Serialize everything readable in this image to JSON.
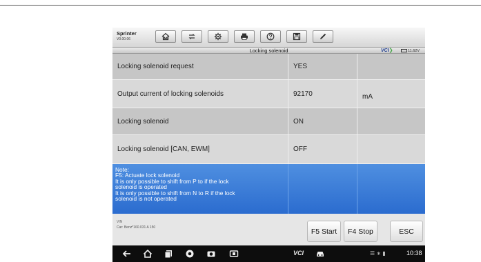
{
  "app": {
    "name": "Sprinter",
    "version": "V0.00.06"
  },
  "toolbar": {
    "buttons": [
      {
        "icon": "home-icon"
      },
      {
        "icon": "vehicle-swap-icon"
      },
      {
        "icon": "gear-icon"
      },
      {
        "icon": "print-icon"
      },
      {
        "icon": "help-icon"
      },
      {
        "icon": "save-icon"
      },
      {
        "icon": "pencil-icon"
      }
    ]
  },
  "header": {
    "title": "Locking solenoid",
    "vci": "VCI",
    "voltage": "11.62V"
  },
  "table": {
    "rows": [
      {
        "name": "Locking solenoid request",
        "value": "YES",
        "unit": ""
      },
      {
        "name": "Output current of locking solenoids",
        "value": "92170",
        "unit": "mA"
      },
      {
        "name": "Locking solenoid",
        "value": "ON",
        "unit": ""
      },
      {
        "name": "Locking solenoid [CAN, EWM]",
        "value": "OFF",
        "unit": ""
      }
    ],
    "note": [
      "Note:",
      "F5: Actuate lock solenoid",
      "It is only possible to shift from P to if the lock",
      "solenoid is operated",
      "It is only possible to shift from N to R if the lock",
      "solenoid is not operated"
    ]
  },
  "footer": {
    "vin_label": "VIN",
    "car": "Car: Benz*160.031 A 150",
    "buttons": {
      "f5": "F5 Start",
      "f4": "F4 Stop",
      "esc": "ESC"
    }
  },
  "navbar": {
    "vcl": "VCI",
    "time": "10:38"
  },
  "colors": {
    "highlight": "#2f73d4",
    "navbar": "#0d0d0d"
  }
}
